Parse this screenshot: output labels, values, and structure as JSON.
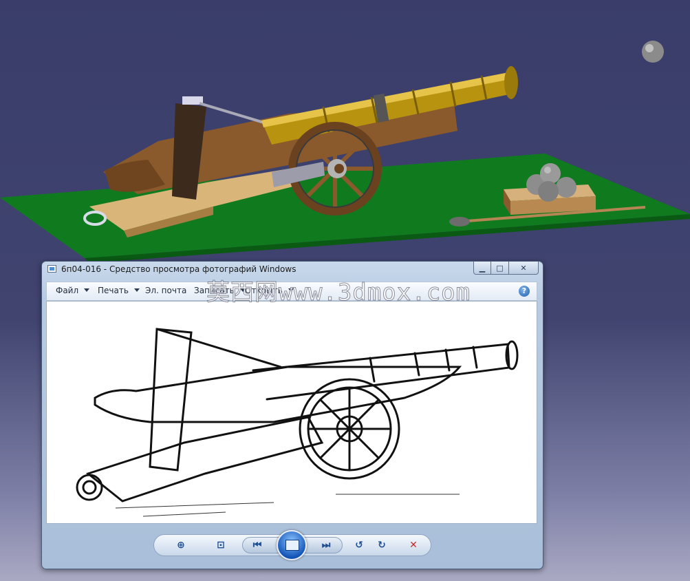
{
  "window": {
    "title": "6п04-016 - Средство просмотра фотографий Windows",
    "minimize_glyph": "▁",
    "maximize_glyph": "□",
    "close_glyph": "✕"
  },
  "menu": {
    "file": "Файл",
    "print": "Печать",
    "email": "Эл. почта",
    "burn": "Записать",
    "open": "Открыть",
    "help_glyph": "?"
  },
  "toolbar": {
    "zoom_glyph": "⊕",
    "fit_glyph": "⊡",
    "prev_glyph": "⏮",
    "next_glyph": "⏭",
    "rotate_ccw_glyph": "↺",
    "rotate_cw_glyph": "↻",
    "delete_glyph": "✕"
  },
  "watermark": "莫西网www.3dmox.com",
  "colors": {
    "cad_background": "#3a3d6a",
    "ground_plane": "#0f7a1e",
    "barrel_brass": "#b8930f",
    "wood": "#8a5a2c",
    "delete_red": "#c62828",
    "nav_blue": "#1f4f93"
  },
  "icons": [
    "photo-viewer-app-icon",
    "zoom-icon",
    "actual-size-icon",
    "previous-icon",
    "slideshow-icon",
    "next-icon",
    "rotate-ccw-icon",
    "rotate-cw-icon",
    "delete-icon",
    "help-icon"
  ]
}
